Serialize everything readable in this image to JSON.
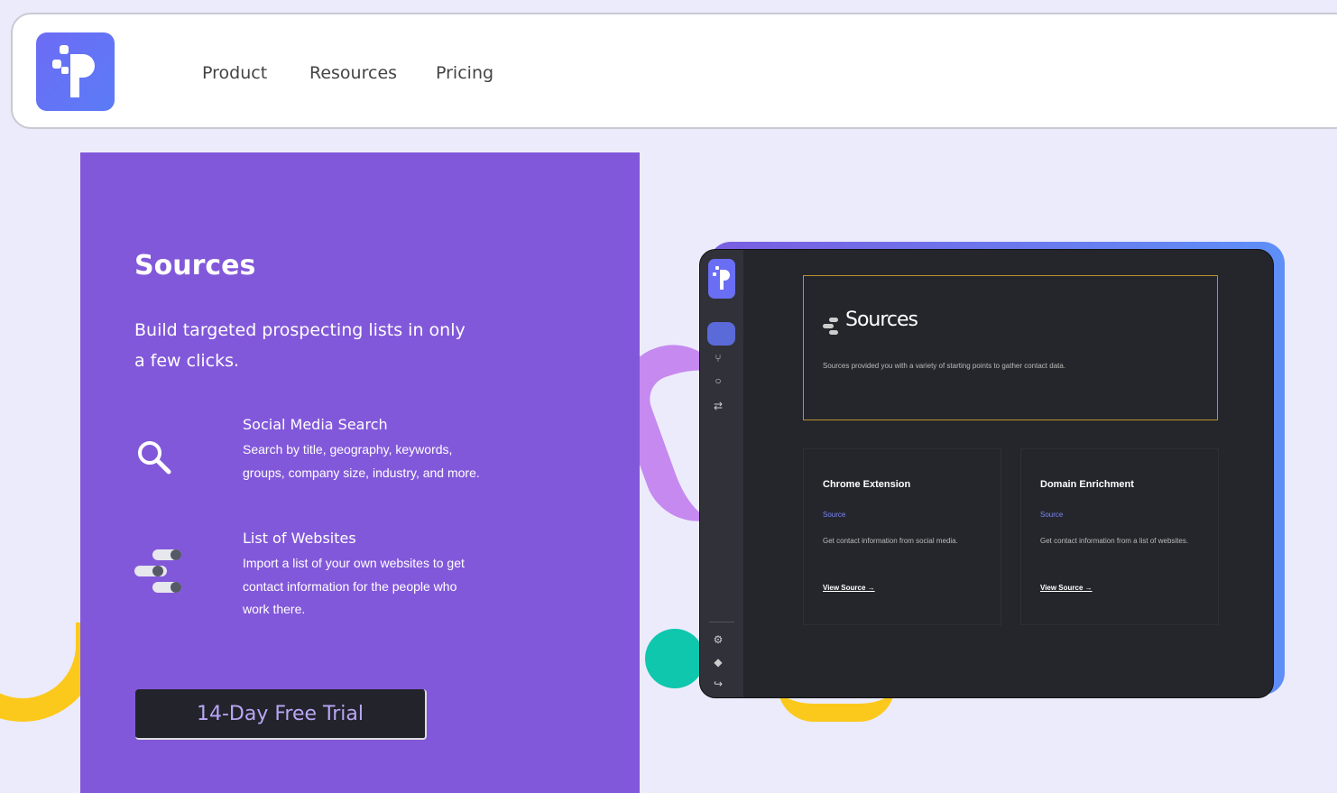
{
  "header": {
    "nav": [
      "Product",
      "Resources",
      "Pricing"
    ]
  },
  "panel": {
    "title": "Sources",
    "subtitle": "Build targeted prospecting lists in only a few clicks.",
    "features": [
      {
        "title": "Social Media Search",
        "description": "Search by title, geography, keywords, groups, company size, industry, and more.",
        "icon": "search-icon"
      },
      {
        "title": "List of Websites",
        "description": "Import a list of your own websites to get contact information for the people who work there.",
        "icon": "toggle-list-icon"
      }
    ],
    "cta": "14-Day Free Trial"
  },
  "app": {
    "hero_title": "Sources",
    "hero_desc": "Sources provided you with a variety of starting points to gather contact data.",
    "cards": [
      {
        "title": "Chrome Extension",
        "type": "Source",
        "description": "Get contact information from social media.",
        "link": "View Source →"
      },
      {
        "title": "Domain Enrichment",
        "type": "Source",
        "description": "Get contact information from a list of websites.",
        "link": "View Source →"
      }
    ]
  },
  "colors": {
    "brand": "#6d6cf5",
    "panel": "#8258da",
    "background": "#ecebfb",
    "app_bg": "#25262c"
  }
}
